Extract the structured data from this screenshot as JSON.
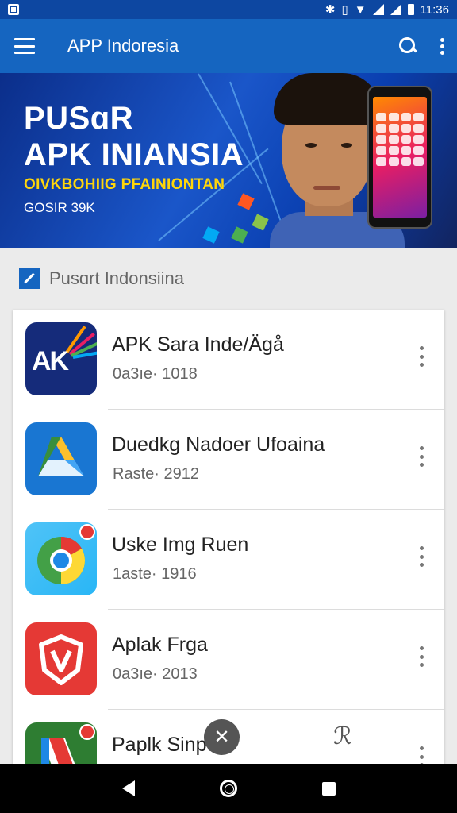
{
  "status_bar": {
    "time": "11:36"
  },
  "app_bar": {
    "title": "APP Indoresia"
  },
  "banner": {
    "title_line1": "PUSɑR",
    "title_line2": "APK INIANSIA",
    "tagline": "OIVKBOHIIG PFAINIONTAN",
    "subtitle": "GOSIR 39K"
  },
  "section": {
    "title": "Pusɑrt Indonsiina"
  },
  "apps": [
    {
      "name": "APK Sara Inde/Ägå",
      "meta": "0a3ıe· 1018",
      "icon": "ak-logo-icon"
    },
    {
      "name": "Duedkg Nadoer Ufoaina",
      "meta": "Raste· 2912",
      "icon": "drive-logo-icon"
    },
    {
      "name": "Uske Img Ruen",
      "meta": "1aste· 1916",
      "icon": "chrome-logo-icon"
    },
    {
      "name": "Aplak Frga",
      "meta": "0a3ıe· 2013",
      "icon": "shield-logo-icon"
    },
    {
      "name": "Paplk Sinpdm",
      "meta": "",
      "icon": "paplk-logo-icon"
    }
  ],
  "colors": {
    "primary": "#1565c0",
    "status_bar": "#0d47a1",
    "accent_yellow": "#ffd60a"
  }
}
